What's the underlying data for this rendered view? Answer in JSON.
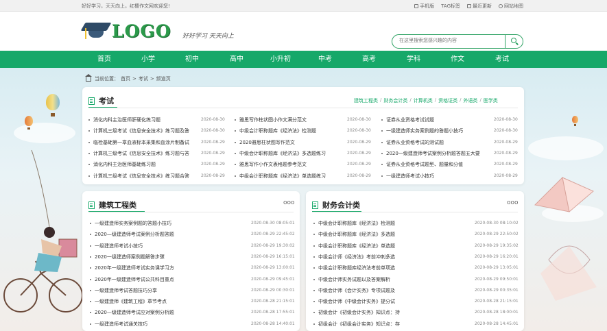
{
  "topbar": {
    "slogan": "好好学习，天天向上，红樱作文网欢迎您!",
    "links": [
      "手机版",
      "TAG标签",
      "最近更新",
      "网站地图"
    ]
  },
  "header": {
    "logo_text": "LOGO",
    "motto": "好好学习 天天向上",
    "search_placeholder": "在这里搜索您感兴趣的内容"
  },
  "nav": [
    "首页",
    "小学",
    "初中",
    "高中",
    "小升初",
    "中考",
    "高考",
    "学科",
    "作文",
    "考试"
  ],
  "breadcrumb": {
    "label": "当前位置：",
    "items": [
      "首页",
      "考试",
      "频道页"
    ],
    "sep": ">"
  },
  "exam": {
    "title": "考试",
    "tabs": [
      "建筑工程类",
      "财务会计类",
      "计算机类",
      "资格证类",
      "外语类",
      "医学类"
    ],
    "columns": [
      [
        {
          "title": "消化内科主治医师肝硬化练习题",
          "date": "2020-08-30"
        },
        {
          "title": "计算机三级考试《信息安全技术》练习题及答",
          "date": "2020-08-30"
        },
        {
          "title": "临检基础第一章血液标本采集和血涂片制备试",
          "date": "2020-08-29"
        },
        {
          "title": "计算机三级考试《信息安全技术》练习题与答",
          "date": "2020-08-29"
        },
        {
          "title": "消化内科主治医师基础练习题",
          "date": "2020-08-29"
        },
        {
          "title": "计算机三级考试《信息安全技术》练习题合答",
          "date": "2020-08-29"
        }
      ],
      [
        {
          "title": "雅思写作柱状图小作文满分范文",
          "date": "2020-08-30"
        },
        {
          "title": "中级会计职称题库《经济法》检测题",
          "date": "2020-08-30"
        },
        {
          "title": "2020雅思柱状图写作范文",
          "date": "2020-08-29"
        },
        {
          "title": "中级会计职称题库《经济法》多选题练习",
          "date": "2020-08-29"
        },
        {
          "title": "雅思写作小作文表格题参考范文",
          "date": "2020-08-29"
        },
        {
          "title": "中级会计职称题库《经济法》单选题练习",
          "date": "2020-08-29"
        }
      ],
      [
        {
          "title": "证券从业资格考试试题",
          "date": "2020-08-30"
        },
        {
          "title": "一级建造师实务案例题的答题小技巧",
          "date": "2020-08-30"
        },
        {
          "title": "证券从业资格考试的测试题",
          "date": "2020-08-29"
        },
        {
          "title": "2020一级建造师考试案例分析题答题五大要",
          "date": "2020-08-29"
        },
        {
          "title": "证券从业资格考试题型、题量和分值",
          "date": "2020-08-29"
        },
        {
          "title": "一级建造师考试小技巧",
          "date": "2020-08-29"
        }
      ]
    ]
  },
  "construction": {
    "title": "建筑工程类",
    "more": "ooo",
    "items": [
      {
        "title": "一级建造师实务案例题的答题小技巧",
        "date": "2020-08-30 08:05:01"
      },
      {
        "title": "2020—级建造师考试案例分析题答题",
        "date": "2020-08-29 22:45:02"
      },
      {
        "title": "一级建造师考试小技巧",
        "date": "2020-08-29 19:30:02"
      },
      {
        "title": "2020一级建造师案例题解答步骤",
        "date": "2020-08-29 16:15:01"
      },
      {
        "title": "2020年一级建造师考试实务课学习方",
        "date": "2020-08-29 13:00:01"
      },
      {
        "title": "2020年一级建造师考试公共科目重点",
        "date": "2020-08-29 09:45:01"
      },
      {
        "title": "一级建造师考试答题技巧分享",
        "date": "2020-08-29 00:30:01"
      },
      {
        "title": "一级建造师《建筑工程》章节考点",
        "date": "2020-08-28 21:15:01"
      },
      {
        "title": "2020—级建造师考试应对案例分析题",
        "date": "2020-08-28 17:55:01"
      },
      {
        "title": "一级建造师考试通关技巧",
        "date": "2020-08-28 14:40:01"
      }
    ]
  },
  "accounting": {
    "title": "财务会计类",
    "more": "ooo",
    "items": [
      {
        "title": "中级会计职称题库《经济法》检测题",
        "date": "2020-08-30 08:10:02"
      },
      {
        "title": "中级会计职称题库《经济法》多选题",
        "date": "2020-08-29 22:50:02"
      },
      {
        "title": "中级会计职称题库《经济法》单选题",
        "date": "2020-08-29 19:35:02"
      },
      {
        "title": "中级会计师《经济法》考前冲刺多选",
        "date": "2020-08-29 16:20:01"
      },
      {
        "title": "中级会计职称题库经济法考前单项选",
        "date": "2020-08-29 13:05:01"
      },
      {
        "title": "中级会计师实务试题以及答案解析",
        "date": "2020-08-29 09:50:01"
      },
      {
        "title": "中级会计师《会计实务》专项试题及",
        "date": "2020-08-29 00:35:01"
      },
      {
        "title": "中级会计师《中级会计实务》提分试",
        "date": "2020-08-28 21:15:01"
      },
      {
        "title": "初级会计《初级会计实务》知识点：持",
        "date": "2020-08-28 18:00:01"
      },
      {
        "title": "初级会计《初级会计实务》知识点：存",
        "date": "2020-08-28 14:45:01"
      }
    ]
  },
  "colors": {
    "accent": "#16a869",
    "topbar": "#f1f1f1"
  }
}
